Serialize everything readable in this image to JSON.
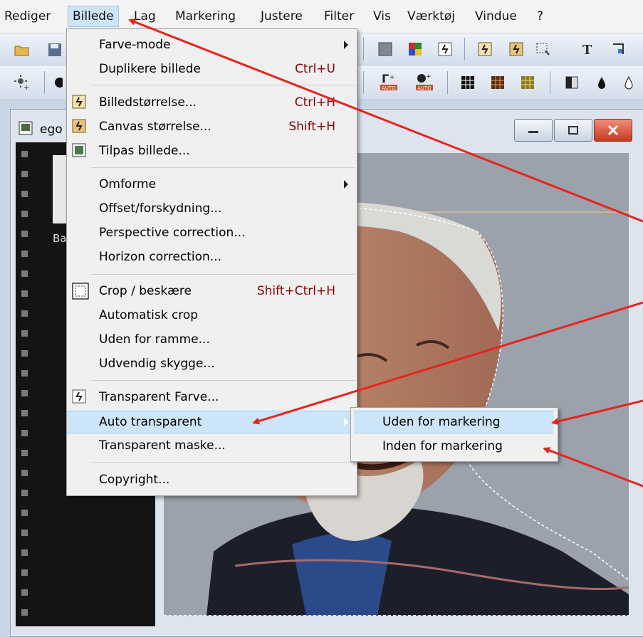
{
  "menubar": {
    "items": [
      "Rediger",
      "Billede",
      "Lag",
      "Markering",
      "Justere",
      "Filter",
      "Vis",
      "Værktøj",
      "Vindue",
      "?"
    ]
  },
  "document": {
    "title": "ego",
    "thumb_label": "Ba"
  },
  "menu": {
    "items": [
      {
        "label": "Farve-mode",
        "shortcut": "",
        "submenu": true
      },
      {
        "label": "Duplikere billede",
        "shortcut": "Ctrl+U"
      },
      {
        "label": "Billedstørrelse...",
        "shortcut": "Ctrl+H",
        "icon": "resize-icon"
      },
      {
        "label": "Canvas størrelse...",
        "shortcut": "Shift+H",
        "icon": "canvas-size-icon"
      },
      {
        "label": "Tilpas billede...",
        "shortcut": "",
        "icon": "fit-image-icon"
      },
      {
        "label": "Omforme",
        "shortcut": "",
        "submenu": true
      },
      {
        "label": "Offset/forskydning...",
        "shortcut": ""
      },
      {
        "label": "Perspective correction...",
        "shortcut": ""
      },
      {
        "label": "Horizon correction...",
        "shortcut": ""
      },
      {
        "label": "Crop / beskære",
        "shortcut": "Shift+Ctrl+H",
        "icon": "crop-icon"
      },
      {
        "label": "Automatisk crop",
        "shortcut": ""
      },
      {
        "label": "Uden for ramme...",
        "shortcut": ""
      },
      {
        "label": "Udvendig skygge...",
        "shortcut": ""
      },
      {
        "label": "Transparent Farve...",
        "shortcut": "",
        "icon": "transparent-color-icon"
      },
      {
        "label": "Auto transparent",
        "shortcut": "",
        "submenu": true
      },
      {
        "label": "Transparent maske...",
        "shortcut": ""
      },
      {
        "label": "Copyright...",
        "shortcut": ""
      }
    ]
  },
  "submenu": {
    "items": [
      "Uden for markering",
      "Inden for markering"
    ]
  },
  "colors": {
    "arrow": "#e8231e",
    "highlight": "#cce5f8",
    "shortcut": "#8b0000"
  }
}
